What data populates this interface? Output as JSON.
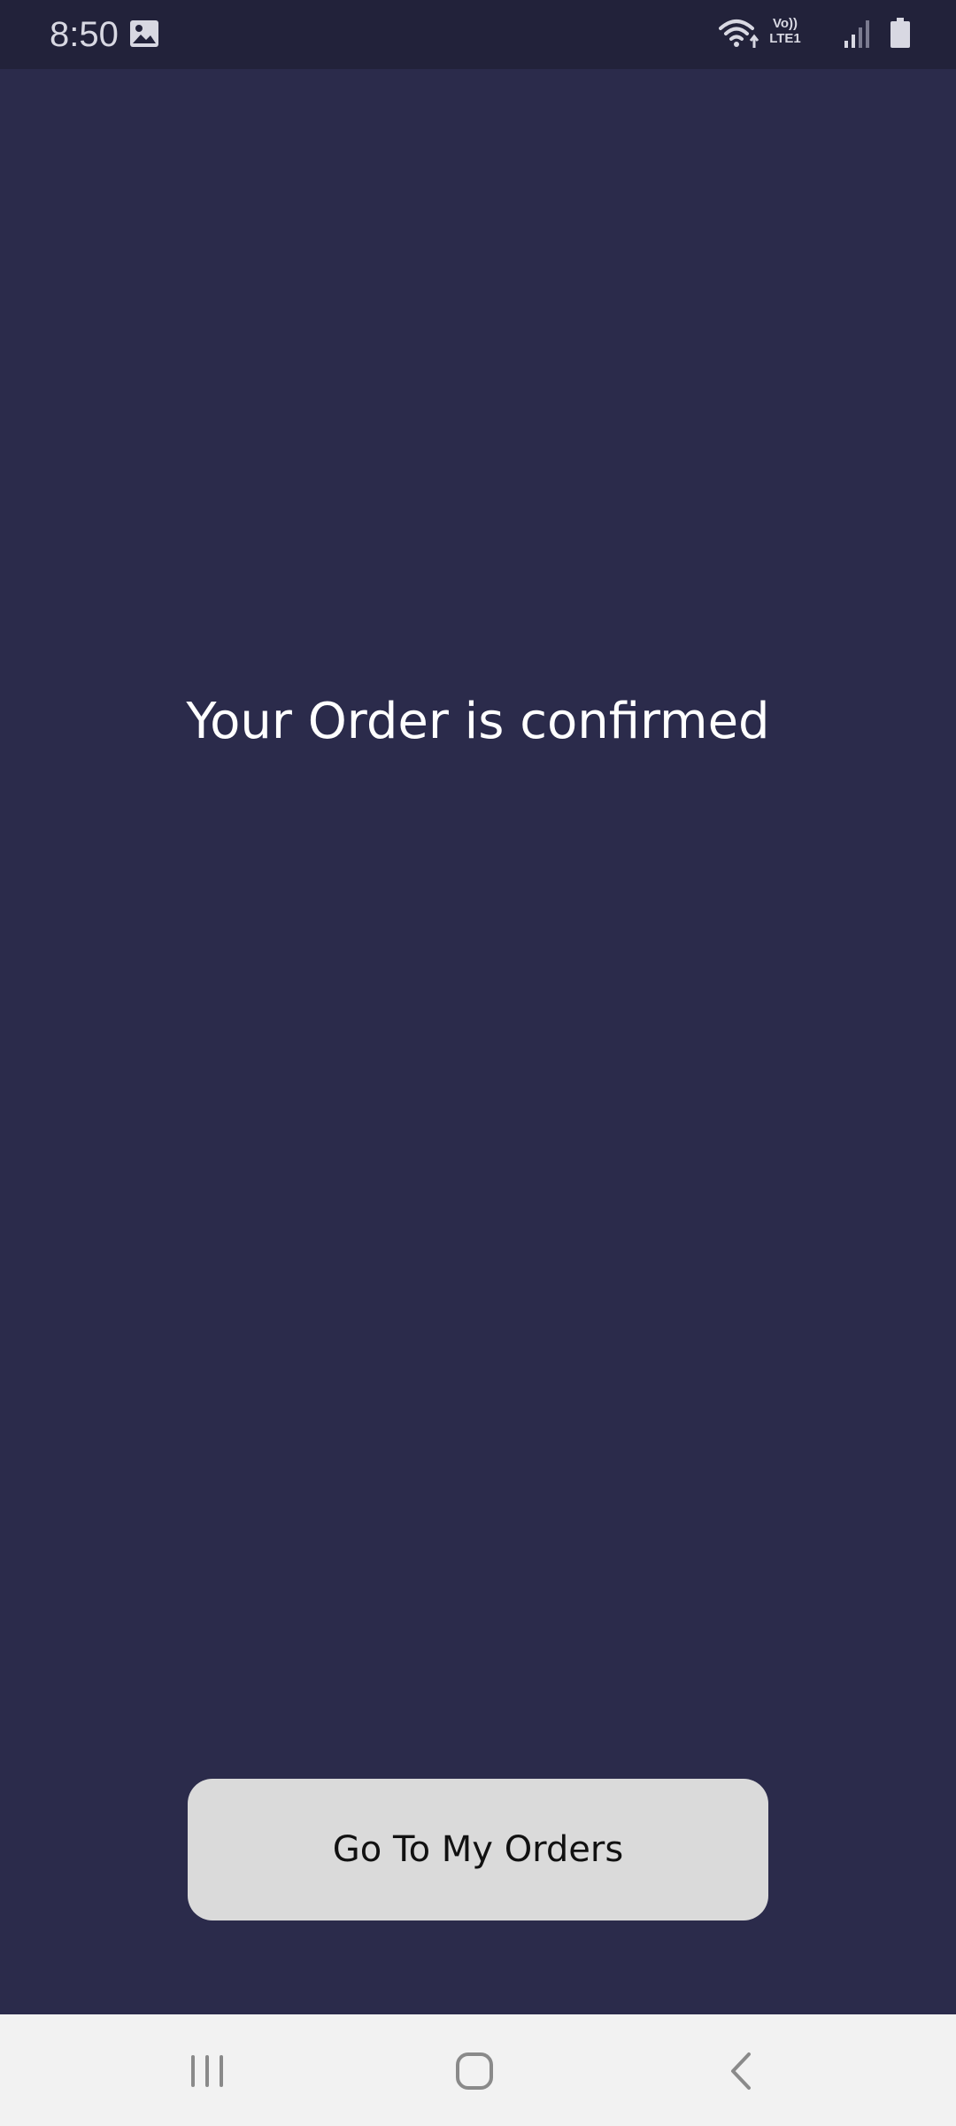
{
  "status_bar": {
    "time": "8:50",
    "icons": [
      "gallery-icon",
      "wifi-icon",
      "volte-lte-icon",
      "signal-icon",
      "battery-icon"
    ],
    "volte_line1": "Vo))",
    "volte_line2": "LTE1"
  },
  "main": {
    "title": "Your Order is confirmed",
    "button_label": "Go To My Orders"
  },
  "nav_bar": {
    "items": [
      "recent-apps",
      "home",
      "back"
    ]
  },
  "colors": {
    "background": "#2b2b4b",
    "status_bar": "#22223a",
    "button": "#dadada",
    "nav_bar": "#f2f2f2"
  }
}
